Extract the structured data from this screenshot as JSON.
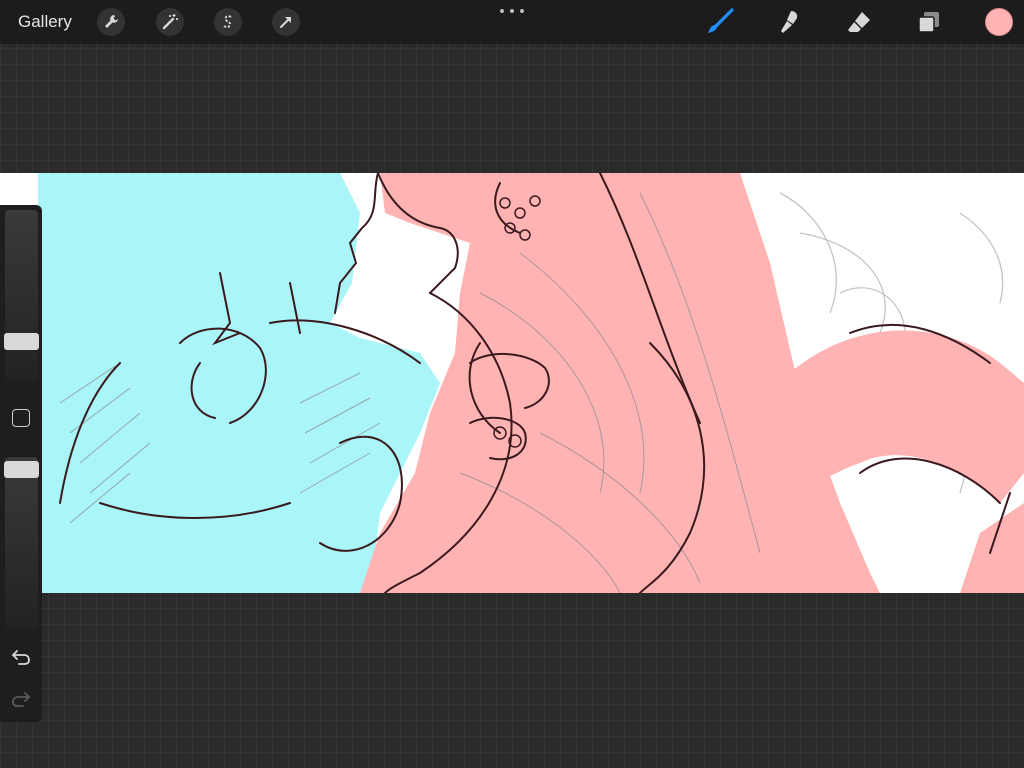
{
  "topbar": {
    "gallery_label": "Gallery",
    "left_tools": [
      "wrench-icon",
      "magic-wand-icon",
      "selection-s-icon",
      "transform-arrow-icon"
    ],
    "right_tools": [
      "brush-icon",
      "smudge-icon",
      "eraser-icon",
      "layers-icon"
    ],
    "active_tool": "brush-icon",
    "active_tool_color": "#1f8fff",
    "current_color": "#ffb3b3"
  },
  "sidebar": {
    "brush_size_level": 0.2,
    "opacity_level": 0.97
  },
  "artwork": {
    "colors": {
      "left_figure": "#aaf5f8",
      "right_figure": "#ffb3b3",
      "line": "#3a1a1e",
      "sketch": "#b8b8b8"
    }
  }
}
